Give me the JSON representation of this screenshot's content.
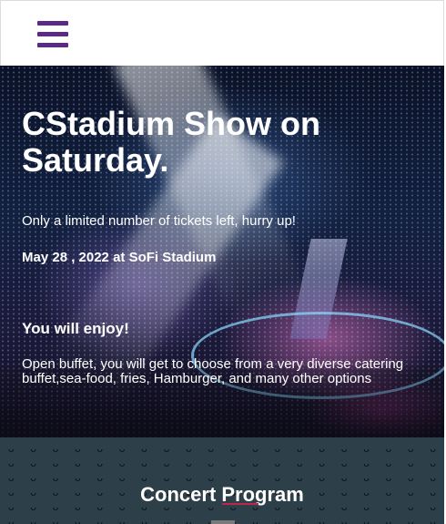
{
  "header": {
    "menu_icon": "hamburger-menu-icon",
    "menu_color": "#5b2a86"
  },
  "hero": {
    "title": "CStadium Show on Saturday.",
    "subtitle": "Only a limited number of tickets left, hurry up!",
    "date": "May 28 , 2022 at SoFi Stadium",
    "enjoy_heading": "You will enjoy!",
    "enjoy_text": "Open buffet, you will get to choose from a very diverse catering buffet,sea-food, fries, Hamburger, and many other options"
  },
  "program": {
    "title": "Concert Program",
    "pattern_glyph": "ᴗ",
    "background_color": "#2d3f48",
    "accent_color": "#c0254a"
  }
}
